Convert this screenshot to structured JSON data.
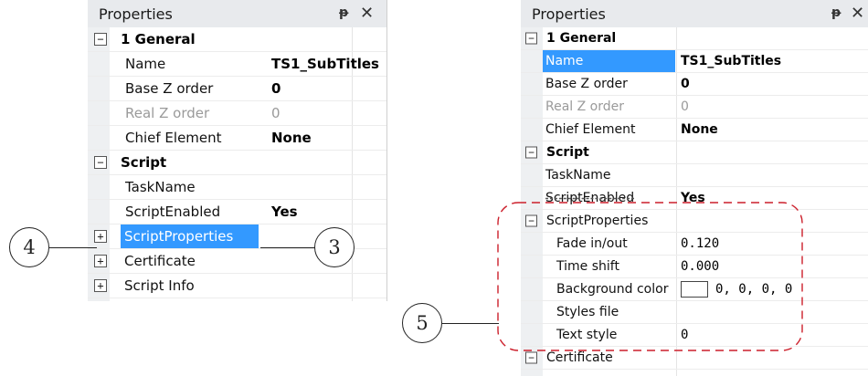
{
  "left_panel": {
    "title": "Properties",
    "pin_glyph": "ᵽ",
    "close_glyph": "✕",
    "rows": [
      {
        "kind": "category",
        "toggle": "⊟",
        "label": "1 General"
      },
      {
        "kind": "prop",
        "label": "Name",
        "value": "TS1_SubTitles"
      },
      {
        "kind": "prop",
        "label": "Base Z order",
        "value": "0"
      },
      {
        "kind": "prop",
        "label": "Real Z order",
        "value": "0"
      },
      {
        "kind": "prop",
        "label": "Chief Element",
        "value": "None"
      },
      {
        "kind": "category",
        "toggle": "⊟",
        "label": "Script"
      },
      {
        "kind": "prop",
        "label": "TaskName",
        "value": ""
      },
      {
        "kind": "prop",
        "label": "ScriptEnabled",
        "value": "Yes"
      },
      {
        "kind": "sub",
        "toggle": "⊞",
        "label": "ScriptProperties",
        "value": ""
      },
      {
        "kind": "sub",
        "toggle": "⊞",
        "label": "Certificate",
        "value": ""
      },
      {
        "kind": "sub",
        "toggle": "⊞",
        "label": "Script Info",
        "value": ""
      }
    ]
  },
  "right_panel": {
    "title": "Properties",
    "pin_glyph": "ᵽ",
    "close_glyph": "✕",
    "rows": [
      {
        "kind": "category",
        "toggle": "⊟",
        "label": "1 General"
      },
      {
        "kind": "prop",
        "label": "Name",
        "value": "TS1_SubTitles"
      },
      {
        "kind": "prop",
        "label": "Base Z order",
        "value": "0"
      },
      {
        "kind": "prop",
        "label": "Real Z order",
        "value": "0"
      },
      {
        "kind": "prop",
        "label": "Chief Element",
        "value": "None"
      },
      {
        "kind": "category",
        "toggle": "⊟",
        "label": "Script"
      },
      {
        "kind": "prop",
        "label": "TaskName",
        "value": ""
      },
      {
        "kind": "prop",
        "label": "ScriptEnabled",
        "value": "Yes"
      },
      {
        "kind": "sub",
        "toggle": "⊟",
        "label": "ScriptProperties",
        "value": ""
      },
      {
        "kind": "prop2",
        "label": "Fade in/out",
        "value": "0.120"
      },
      {
        "kind": "prop2",
        "label": "Time shift",
        "value": "0.000"
      },
      {
        "kind": "prop2",
        "label": "Background color",
        "value": "0, 0, 0, 0"
      },
      {
        "kind": "prop2",
        "label": "Styles file",
        "value": ""
      },
      {
        "kind": "prop2",
        "label": "Text style",
        "value": "0"
      },
      {
        "kind": "sub",
        "toggle": "⊟",
        "label": "Certificate",
        "value": ""
      }
    ]
  },
  "callouts": [
    "4",
    "3",
    "5"
  ],
  "colors": {
    "selection": "#3399ff",
    "dash": "#cc1f2b"
  }
}
